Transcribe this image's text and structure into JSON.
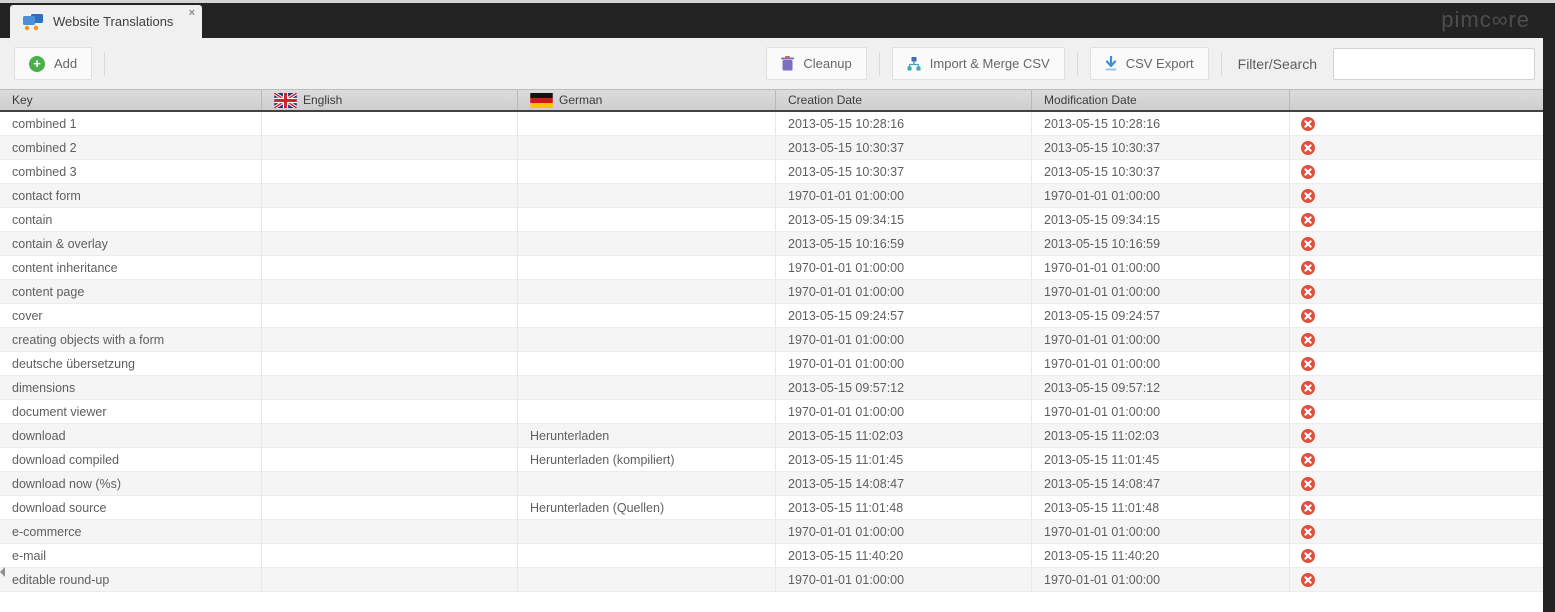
{
  "window": {
    "tab_title": "Website Translations",
    "tab_close": "×",
    "logo_text": "pimc∞re"
  },
  "toolbar": {
    "add_label": "Add",
    "cleanup_label": "Cleanup",
    "import_label": "Import & Merge CSV",
    "export_label": "CSV Export",
    "filter_label": "Filter/Search",
    "filter_value": ""
  },
  "table": {
    "columns": [
      "Key",
      "English",
      "German",
      "Creation Date",
      "Modification Date",
      ""
    ],
    "rows": [
      {
        "key": "combined 1",
        "english": "",
        "german": "",
        "creation": "2013-05-15 10:28:16",
        "modification": "2013-05-15 10:28:16"
      },
      {
        "key": "combined 2",
        "english": "",
        "german": "",
        "creation": "2013-05-15 10:30:37",
        "modification": "2013-05-15 10:30:37"
      },
      {
        "key": "combined 3",
        "english": "",
        "german": "",
        "creation": "2013-05-15 10:30:37",
        "modification": "2013-05-15 10:30:37"
      },
      {
        "key": "contact form",
        "english": "",
        "german": "",
        "creation": "1970-01-01 01:00:00",
        "modification": "1970-01-01 01:00:00"
      },
      {
        "key": "contain",
        "english": "",
        "german": "",
        "creation": "2013-05-15 09:34:15",
        "modification": "2013-05-15 09:34:15"
      },
      {
        "key": "contain & overlay",
        "english": "",
        "german": "",
        "creation": "2013-05-15 10:16:59",
        "modification": "2013-05-15 10:16:59"
      },
      {
        "key": "content inheritance",
        "english": "",
        "german": "",
        "creation": "1970-01-01 01:00:00",
        "modification": "1970-01-01 01:00:00"
      },
      {
        "key": "content page",
        "english": "",
        "german": "",
        "creation": "1970-01-01 01:00:00",
        "modification": "1970-01-01 01:00:00"
      },
      {
        "key": "cover",
        "english": "",
        "german": "",
        "creation": "2013-05-15 09:24:57",
        "modification": "2013-05-15 09:24:57"
      },
      {
        "key": "creating objects with a form",
        "english": "",
        "german": "",
        "creation": "1970-01-01 01:00:00",
        "modification": "1970-01-01 01:00:00"
      },
      {
        "key": "deutsche übersetzung",
        "english": "",
        "german": "",
        "creation": "1970-01-01 01:00:00",
        "modification": "1970-01-01 01:00:00"
      },
      {
        "key": "dimensions",
        "english": "",
        "german": "",
        "creation": "2013-05-15 09:57:12",
        "modification": "2013-05-15 09:57:12"
      },
      {
        "key": "document viewer",
        "english": "",
        "german": "",
        "creation": "1970-01-01 01:00:00",
        "modification": "1970-01-01 01:00:00"
      },
      {
        "key": "download",
        "english": "",
        "german": "Herunterladen",
        "creation": "2013-05-15 11:02:03",
        "modification": "2013-05-15 11:02:03"
      },
      {
        "key": "download compiled",
        "english": "",
        "german": "Herunterladen (kompiliert)",
        "creation": "2013-05-15 11:01:45",
        "modification": "2013-05-15 11:01:45"
      },
      {
        "key": "download now (%s)",
        "english": "",
        "german": "",
        "creation": "2013-05-15 14:08:47",
        "modification": "2013-05-15 14:08:47"
      },
      {
        "key": "download source",
        "english": "",
        "german": "Herunterladen (Quellen)",
        "creation": "2013-05-15 11:01:48",
        "modification": "2013-05-15 11:01:48"
      },
      {
        "key": "e-commerce",
        "english": "",
        "german": "",
        "creation": "1970-01-01 01:00:00",
        "modification": "1970-01-01 01:00:00"
      },
      {
        "key": "e-mail",
        "english": "",
        "german": "",
        "creation": "2013-05-15 11:40:20",
        "modification": "2013-05-15 11:40:20"
      },
      {
        "key": "editable round-up",
        "english": "",
        "german": "",
        "creation": "1970-01-01 01:00:00",
        "modification": "1970-01-01 01:00:00"
      }
    ]
  },
  "colors": {
    "dark_bar": "#232323",
    "toolbar_bg": "#f0f0f0",
    "header_bg": "#d5d5d5",
    "row_alt": "#f5f5f5",
    "add_green": "#4cae4c",
    "delete_red": "#e14f3d",
    "cleanup_purple": "#7d6ec2",
    "csv_blue": "#3b8fd4"
  }
}
